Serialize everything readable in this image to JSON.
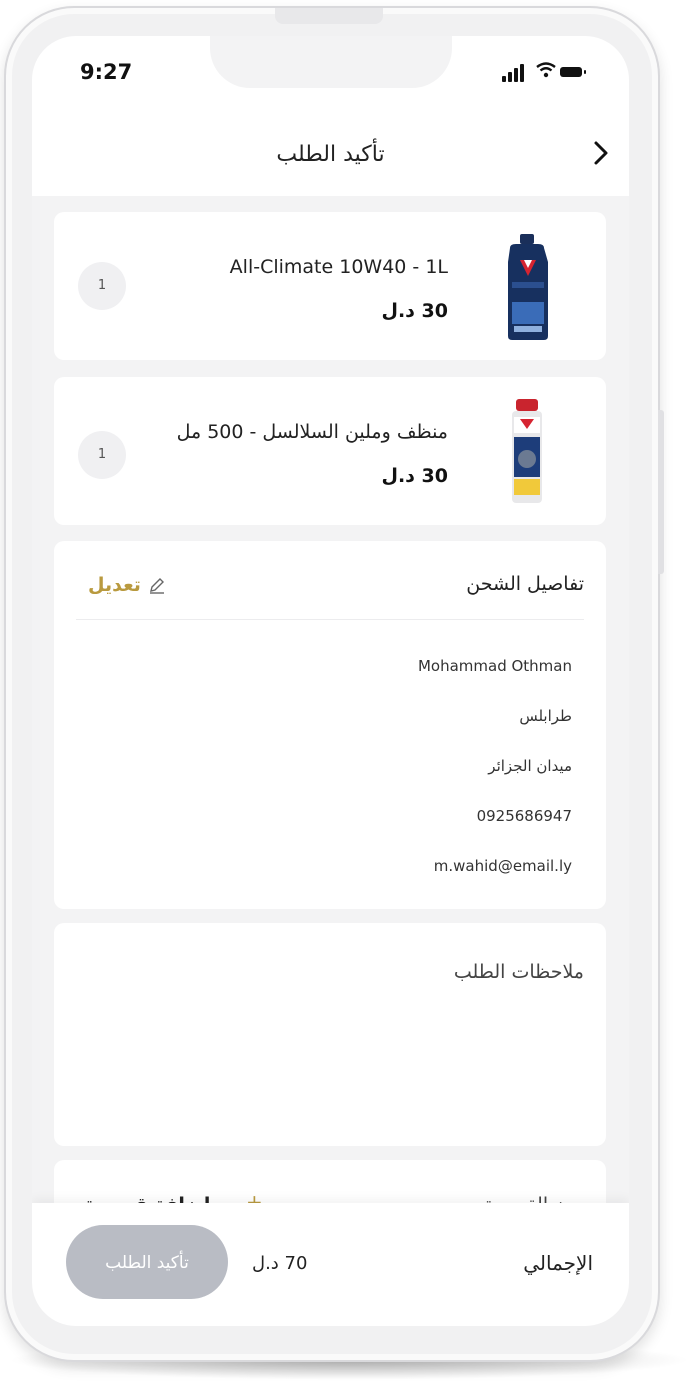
{
  "status_bar": {
    "time": "9:27"
  },
  "header": {
    "title": "تأكيد الطلب"
  },
  "products": [
    {
      "name": "All-Climate 10W40 - 1L",
      "price": "30 د.ل",
      "qty": "1",
      "image": "oil-bottle"
    },
    {
      "name": "منظف وملين السلالسل - 500 مل",
      "price": "30 د.ل",
      "qty": "1",
      "image": "spray-can"
    }
  ],
  "shipping": {
    "title": "تفاصيل الشحن",
    "edit_label": "تعديل",
    "name": "Mohammad Othman",
    "city": "طرابلس",
    "street": "ميدان الجزائر",
    "phone": "0925686947",
    "email": "m.wahid@email.ly"
  },
  "notes": {
    "placeholder": "ملاحظات الطلب"
  },
  "coupon": {
    "label": "رمز القسيمة",
    "add_label": "إضافة قسيمة"
  },
  "footer": {
    "total_label": "الإجمالي",
    "total_value": "70 د.ل",
    "confirm_label": "تأكيد الطلب"
  },
  "colors": {
    "accent": "#b99a3f",
    "disabled_button": "#b9bcc4",
    "background": "#f3f3f4"
  }
}
